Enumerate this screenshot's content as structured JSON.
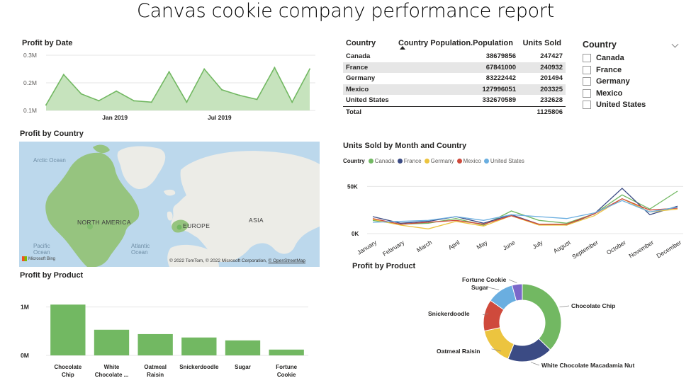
{
  "report": {
    "title": "Canvas cookie company performance report"
  },
  "profit_by_date": {
    "title": "Profit by Date",
    "y_ticks": [
      "0.3M",
      "0.2M",
      "0.1M"
    ],
    "x_ticks": [
      "Jan 2019",
      "Jul 2019"
    ]
  },
  "table": {
    "headers": {
      "country": "Country",
      "population": "Country Population.Population",
      "units": "Units Sold"
    },
    "rows": [
      {
        "country": "Canada",
        "population": "38679856",
        "units": "247427"
      },
      {
        "country": "France",
        "population": "67841000",
        "units": "240932"
      },
      {
        "country": "Germany",
        "population": "83222442",
        "units": "201494"
      },
      {
        "country": "Mexico",
        "population": "127996051",
        "units": "203325"
      },
      {
        "country": "United States",
        "population": "332670589",
        "units": "232628"
      }
    ],
    "total": {
      "label": "Total",
      "units": "1125806"
    }
  },
  "slicer": {
    "title": "Country",
    "options": [
      "Canada",
      "France",
      "Germany",
      "Mexico",
      "United States"
    ]
  },
  "profit_by_country": {
    "title": "Profit by Country",
    "labels": {
      "arctic": "Arctic Ocean",
      "north_america": "NORTH AMERICA",
      "europe": "EUROPE",
      "asia": "ASIA",
      "pacific": "Pacific Ocean",
      "atlantic": "Atlantic Ocean"
    },
    "bing": "Microsoft Bing",
    "copyright_prefix": "© 2022 TomTom, © 2022 Microsoft Corporation, ",
    "copyright_link": "© OpenStreetMap"
  },
  "units_by_month": {
    "title": "Units Sold by Month and Country",
    "legend_title": "Country",
    "y_ticks": [
      "50K",
      "0K"
    ],
    "months": [
      "January",
      "February",
      "March",
      "April",
      "May",
      "June",
      "July",
      "August",
      "September",
      "October",
      "November",
      "December"
    ]
  },
  "profit_by_product_bar": {
    "title": "Profit by Product",
    "y_ticks": [
      "1M",
      "0M"
    ],
    "categories": [
      [
        "Chocolate",
        "Chip"
      ],
      [
        "White",
        "Chocolate ..."
      ],
      [
        "Oatmeal",
        "Raisin"
      ],
      [
        "Snickerdoodle"
      ],
      [
        "Sugar"
      ],
      [
        "Fortune",
        "Cookie"
      ]
    ]
  },
  "profit_by_product_donut": {
    "title": "Profit by Product",
    "labels": {
      "chocolate_chip": "Chocolate Chip",
      "white_chocolate": "White Chocolate Macadamia Nut",
      "oatmeal_raisin": "Oatmeal Raisin",
      "snickerdoodle": "Snickerdoodle",
      "sugar": "Sugar",
      "fortune_cookie": "Fortune Cookie"
    }
  },
  "colors": {
    "green": "#72b862",
    "green_fill": "#c6e3bd",
    "navy": "#3b4b84",
    "yellow": "#ecc43f",
    "red": "#cf4a3c",
    "blue": "#6aaee0",
    "purple": "#7b68c9",
    "land": "#ecece7",
    "na_land": "#96c47f"
  },
  "chart_data": [
    {
      "type": "area",
      "title": "Profit by Date",
      "x": [
        "2018-09",
        "2018-10",
        "2018-11",
        "2018-12",
        "2019-01",
        "2019-02",
        "2019-03",
        "2019-04",
        "2019-05",
        "2019-06",
        "2019-07",
        "2019-08",
        "2019-09",
        "2019-10",
        "2019-11",
        "2019-12"
      ],
      "values": [
        0.12,
        0.23,
        0.16,
        0.135,
        0.17,
        0.135,
        0.13,
        0.24,
        0.13,
        0.25,
        0.175,
        0.155,
        0.14,
        0.255,
        0.13,
        0.25
      ],
      "ylim": [
        0.1,
        0.3
      ],
      "unit": "M"
    },
    {
      "type": "line",
      "title": "Units Sold by Month and Country",
      "categories": [
        "January",
        "February",
        "March",
        "April",
        "May",
        "June",
        "July",
        "August",
        "September",
        "October",
        "November",
        "December"
      ],
      "series": [
        {
          "name": "Canada",
          "color": "#72b862",
          "values": [
            14,
            10,
            11,
            16,
            9,
            24,
            14,
            11,
            21,
            41,
            26,
            45
          ]
        },
        {
          "name": "France",
          "color": "#3b4b84",
          "values": [
            18,
            11,
            13,
            18,
            11,
            20,
            10,
            9,
            21,
            48,
            20,
            29
          ]
        },
        {
          "name": "Germany",
          "color": "#ecc43f",
          "values": [
            15,
            9,
            5,
            13,
            8,
            19,
            9,
            9,
            19,
            37,
            23,
            26
          ]
        },
        {
          "name": "Mexico",
          "color": "#cf4a3c",
          "values": [
            16,
            10,
            12,
            14,
            10,
            19,
            10,
            10,
            21,
            37,
            25,
            27
          ]
        },
        {
          "name": "United States",
          "color": "#6aaee0",
          "values": [
            12,
            13,
            14,
            18,
            14,
            20,
            18,
            16,
            22,
            35,
            23,
            28
          ]
        }
      ],
      "ylim": [
        0,
        60
      ],
      "unit": "K"
    },
    {
      "type": "bar",
      "title": "Profit by Product",
      "categories": [
        "Chocolate Chip",
        "White Chocolate ...",
        "Oatmeal Raisin",
        "Snickerdoodle",
        "Sugar",
        "Fortune Cookie"
      ],
      "values": [
        1.05,
        0.53,
        0.44,
        0.37,
        0.31,
        0.12
      ],
      "ylim": [
        0,
        1.2
      ],
      "unit": "M"
    },
    {
      "type": "pie",
      "title": "Profit by Product",
      "categories": [
        "Chocolate Chip",
        "White Chocolate Macadamia Nut",
        "Oatmeal Raisin",
        "Snickerdoodle",
        "Sugar",
        "Fortune Cookie"
      ],
      "values": [
        1.05,
        0.53,
        0.44,
        0.37,
        0.31,
        0.12
      ]
    }
  ]
}
